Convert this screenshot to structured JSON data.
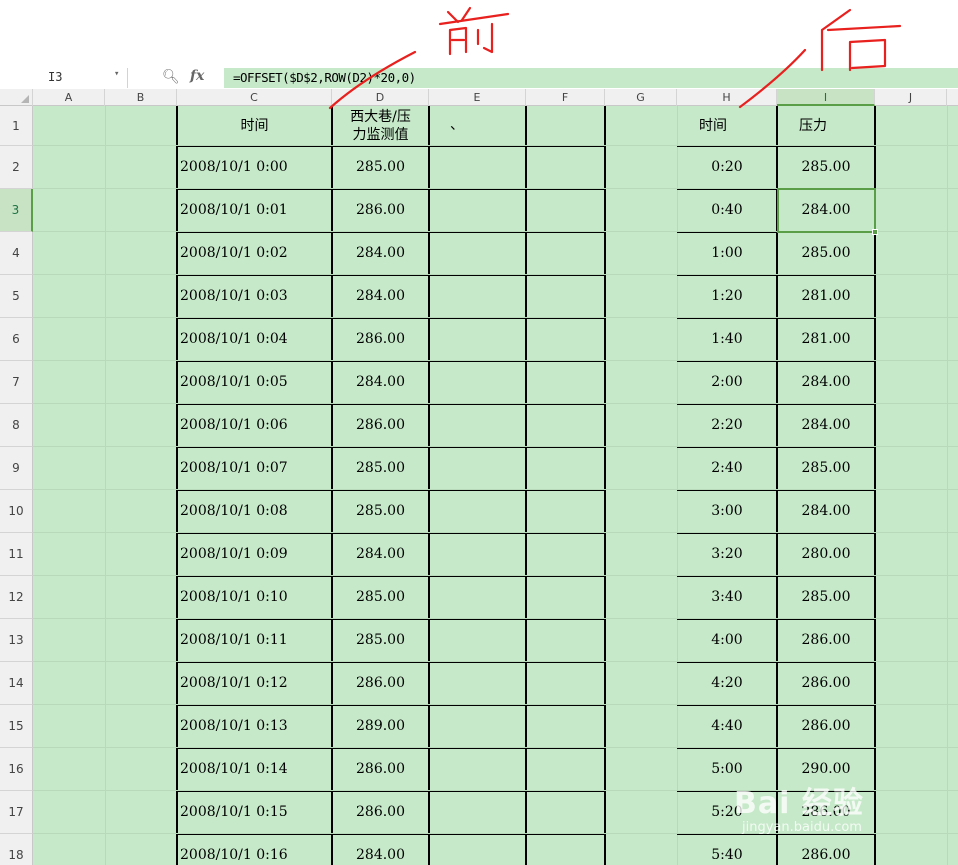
{
  "formula_bar": {
    "cell_ref": "I3",
    "fx_label": "fx",
    "formula": "=OFFSET($D$2,ROW(D2)*20,0)"
  },
  "annotations": {
    "before": "前",
    "after": "后"
  },
  "columns": [
    "A",
    "B",
    "C",
    "D",
    "E",
    "F",
    "G",
    "H",
    "I",
    "J"
  ],
  "selected_column": "I",
  "selected_row": "3",
  "headers": {
    "c": "时间",
    "d_line1": "西大巷/压",
    "d_line2": "力监测值",
    "e": "、",
    "h": "时间",
    "i": "压力"
  },
  "rows": [
    {
      "num": "2",
      "c": "2008/10/1 0:00",
      "d": "285.00",
      "h": "0:20",
      "i": "285.00"
    },
    {
      "num": "3",
      "c": "2008/10/1 0:01",
      "d": "286.00",
      "h": "0:40",
      "i": "284.00"
    },
    {
      "num": "4",
      "c": "2008/10/1 0:02",
      "d": "284.00",
      "h": "1:00",
      "i": "285.00"
    },
    {
      "num": "5",
      "c": "2008/10/1 0:03",
      "d": "284.00",
      "h": "1:20",
      "i": "281.00"
    },
    {
      "num": "6",
      "c": "2008/10/1 0:04",
      "d": "286.00",
      "h": "1:40",
      "i": "281.00"
    },
    {
      "num": "7",
      "c": "2008/10/1 0:05",
      "d": "284.00",
      "h": "2:00",
      "i": "284.00"
    },
    {
      "num": "8",
      "c": "2008/10/1 0:06",
      "d": "286.00",
      "h": "2:20",
      "i": "284.00"
    },
    {
      "num": "9",
      "c": "2008/10/1 0:07",
      "d": "285.00",
      "h": "2:40",
      "i": "285.00"
    },
    {
      "num": "10",
      "c": "2008/10/1 0:08",
      "d": "285.00",
      "h": "3:00",
      "i": "284.00"
    },
    {
      "num": "11",
      "c": "2008/10/1 0:09",
      "d": "284.00",
      "h": "3:20",
      "i": "280.00"
    },
    {
      "num": "12",
      "c": "2008/10/1 0:10",
      "d": "285.00",
      "h": "3:40",
      "i": "285.00"
    },
    {
      "num": "13",
      "c": "2008/10/1 0:11",
      "d": "285.00",
      "h": "4:00",
      "i": "286.00"
    },
    {
      "num": "14",
      "c": "2008/10/1 0:12",
      "d": "286.00",
      "h": "4:20",
      "i": "286.00"
    },
    {
      "num": "15",
      "c": "2008/10/1 0:13",
      "d": "289.00",
      "h": "4:40",
      "i": "286.00"
    },
    {
      "num": "16",
      "c": "2008/10/1 0:14",
      "d": "286.00",
      "h": "5:00",
      "i": "290.00"
    },
    {
      "num": "17",
      "c": "2008/10/1 0:15",
      "d": "286.00",
      "h": "5:20",
      "i": "286.00"
    },
    {
      "num": "18",
      "c": "2008/10/1 0:16",
      "d": "284.00",
      "h": "5:40",
      "i": "286.00"
    }
  ],
  "watermark": {
    "logo": "Bai  经验",
    "url": "jingyan.baidu.com"
  },
  "colors": {
    "sheet_bg": "#c6e9c9",
    "selection": "#5a9e48",
    "ink": "#e8201e"
  }
}
